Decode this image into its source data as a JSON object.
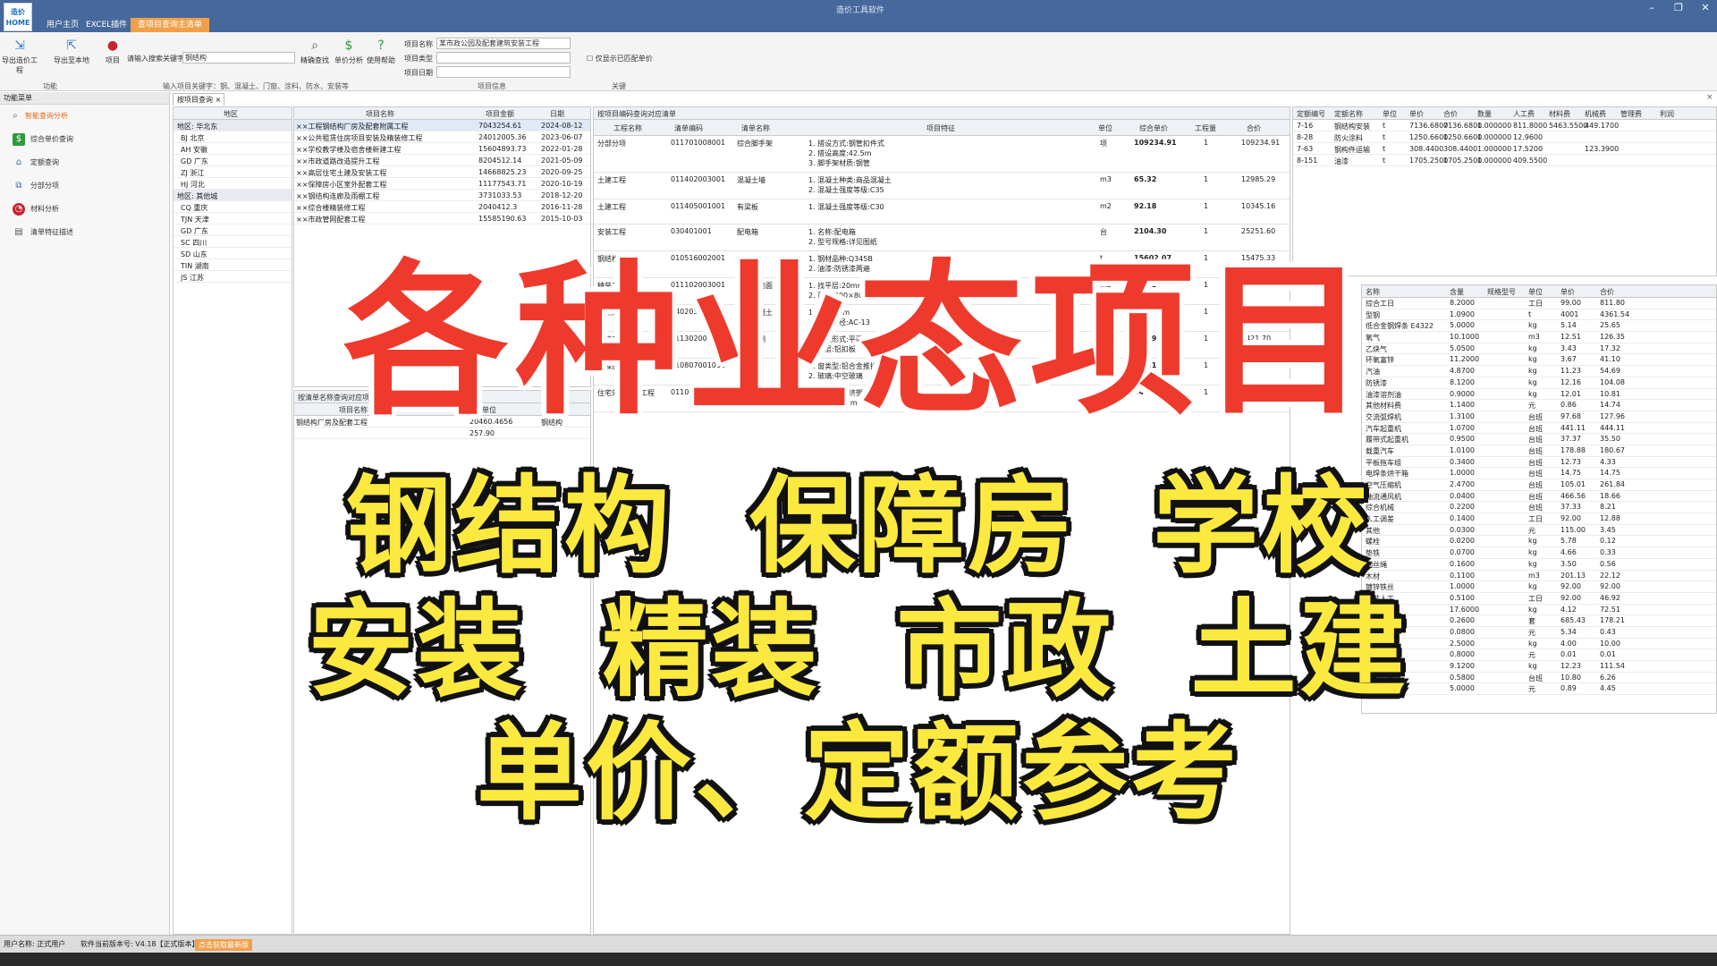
{
  "app": {
    "logo_text": "造价 HOME",
    "window_title": "造价工具软件",
    "menu_tabs": [
      "用户主页",
      "EXCEL插件",
      "查项目查询主清单"
    ],
    "active_tab_index": 2
  },
  "ribbon": {
    "buttons": [
      {
        "label": "导出造价工程",
        "icon": "export-icon"
      },
      {
        "label": "导出至本地",
        "icon": "export-local-icon"
      },
      {
        "label": "项目",
        "icon": "chart-icon"
      }
    ],
    "search_label": "请输入搜索关键字",
    "search_value": "钢结构",
    "tool_buttons": [
      {
        "label": "精确查找",
        "icon": "magnifier-icon"
      },
      {
        "label": "单价分析",
        "icon": "dollar-icon"
      },
      {
        "label": "使用帮助",
        "icon": "help-icon"
      }
    ],
    "info_fields": [
      {
        "label": "项目名称",
        "value": "某市政公园及配套建筑安装工程"
      },
      {
        "label": "项目类型",
        "value": ""
      },
      {
        "label": "项目日期",
        "value": ""
      }
    ],
    "checkbox_label": "仅显示已匹配单价",
    "groups": [
      "功能",
      "输入项目关键字：钢、混凝土、门窗、涂料、防水、安装等",
      "项目信息",
      "关键"
    ]
  },
  "sidebar": {
    "title": "功能菜单",
    "items": [
      {
        "label": "智能查询分析",
        "icon": "search-icon",
        "color": "#e06a1a"
      },
      {
        "label": "综合单价查询",
        "icon": "dollar-icon",
        "color": "#2e9a3b"
      },
      {
        "label": "定额查询",
        "icon": "house-icon",
        "color": "#2a6ccf"
      },
      {
        "label": "分部分项",
        "icon": "tree-icon",
        "color": "#3b6fb6"
      },
      {
        "label": "材料分析",
        "icon": "pie-icon",
        "color": "#c8242e"
      },
      {
        "label": "清单特征描述",
        "icon": "document-icon",
        "color": "#555555"
      }
    ]
  },
  "doc_tab": "按项目查询",
  "region_panel": {
    "header": "地区",
    "rows": [
      {
        "text": "地区: 华北东",
        "group": true
      },
      {
        "text": "BJ 北京"
      },
      {
        "text": "AH 安徽"
      },
      {
        "text": "GD 广东"
      },
      {
        "text": "ZJ 浙江"
      },
      {
        "text": "HJ 河北"
      },
      {
        "text": "地区: 其他城",
        "group": true
      },
      {
        "text": "CQ 重庆"
      },
      {
        "text": "TJN 天津"
      },
      {
        "text": "GD 广东"
      },
      {
        "text": "SC 四川"
      },
      {
        "text": "SD 山东"
      },
      {
        "text": "TIN 湖南"
      },
      {
        "text": "JS 江苏"
      }
    ]
  },
  "project_panel": {
    "headers": [
      "项目名称",
      "项目金额",
      "日期"
    ],
    "rows": [
      [
        "××工程钢结构厂房及配套附属工程",
        "7043254.61",
        "2024-08-12"
      ],
      [
        "××公共租赁住房项目安装及精装修工程",
        "24012005.36",
        "2023-06-07"
      ],
      [
        "××学校教学楼及宿舍楼新建工程",
        "15604893.73",
        "2022-01-28"
      ],
      [
        "××市政道路改造提升工程",
        "8204512.14",
        "2021-05-09"
      ],
      [
        "××高层住宅土建及安装工程",
        "14668825.23",
        "2020-09-25"
      ],
      [
        "××保障房小区室外配套工程",
        "11177543.71",
        "2020-10-19"
      ],
      [
        "××钢结构连廊及雨棚工程",
        "3731033.53",
        "2018-12-20"
      ],
      [
        "××综合楼精装修工程",
        "2040412.3",
        "2016-11-28"
      ],
      [
        "××市政管网配套工程",
        "15585190.63",
        "2015-10-03"
      ]
    ]
  },
  "sub_panel": {
    "title": "按清单名称查询对应项目",
    "headers": [
      "项目名称",
      "单位",
      "单价"
    ],
    "rows": [
      [
        "钢结构厂房及配套工程",
        "20460.4656",
        "钢结构"
      ],
      [
        "",
        "257.90",
        ""
      ]
    ]
  },
  "main_table": {
    "title": "按项目编码查询对应清单",
    "headers": [
      "工程名称",
      "清单编码",
      "清单名称",
      "项目特征",
      "单位",
      "综合单价",
      "工程量",
      "合价"
    ],
    "rows": [
      {
        "name": "分部分项",
        "code": "011701008001",
        "item": "综合脚手架",
        "desc": "1. 搭设方式:钢管扣件式\n2. 搭设高度:42.5m\n3. 脚手架材质:钢管",
        "unit": "项",
        "price": "109234.91",
        "qty": "1",
        "total": "109234.91"
      },
      {
        "name": "土建工程",
        "code": "011402003001",
        "item": "混凝土墙",
        "desc": "1. 混凝土种类:商品混凝土\n2. 混凝土强度等级:C35",
        "unit": "m3",
        "price": "65.32",
        "qty": "1",
        "total": "12985.29"
      },
      {
        "name": "土建工程",
        "code": "011405001001",
        "item": "有梁板",
        "desc": "1. 混凝土强度等级:C30",
        "unit": "m2",
        "price": "92.18",
        "qty": "1",
        "total": "10345.16"
      },
      {
        "name": "安装工程",
        "code": "030401001",
        "item": "配电箱",
        "desc": "1. 名称:配电箱\n2. 型号规格:详见图纸",
        "unit": "台",
        "price": "2104.30",
        "qty": "1",
        "total": "25251.60"
      },
      {
        "name": "钢结构工程",
        "code": "010516002001",
        "item": "钢构件",
        "desc": "1. 钢材品种:Q345B\n2. 油漆:防锈漆两遍",
        "unit": "t",
        "price": "15602.07",
        "qty": "1",
        "total": "15475.33"
      },
      {
        "name": "精装工程",
        "code": "011102003001",
        "item": "块料楼地面",
        "desc": "1. 找平层:20mm水泥砂浆\n2. 面层:800×800地砖",
        "unit": "m2",
        "price": "77.08",
        "qty": "1",
        "total": "5214.60"
      },
      {
        "name": "市政工程",
        "code": "040203006001",
        "item": "沥青混凝土",
        "desc": "1. 厚度:5cm\n2. 石料粒径:AC-13",
        "unit": "m2",
        "price": "535.31",
        "qty": "1",
        "total": "8126.52"
      },
      {
        "name": "学校工程",
        "code": "011302001001",
        "item": "吊顶天棚",
        "desc": "1. 吊顶形式:平面\n2. 面层:铝扣板",
        "unit": "m2",
        "price": "99.19",
        "qty": "1",
        "total": "3421.70"
      },
      {
        "name": "保障房工程",
        "code": "010807001001",
        "item": "金属窗",
        "desc": "1. 窗类型:铝合金推拉窗\n2. 玻璃:中空玻璃",
        "unit": "m2",
        "price": "415.19",
        "qty": "1",
        "total": "21050.40"
      },
      {
        "name": "住宅外墙保温工程",
        "code": "011001003001",
        "item": "保温隔热墙面",
        "desc": "1. 保温材料:挤塑聚苯板\n2. 厚度:30mm",
        "unit": "m2",
        "price": "547.23",
        "qty": "1",
        "total": "70408.26"
      }
    ]
  },
  "quota_table": {
    "headers": [
      "定额编号",
      "定额名称",
      "单位",
      "单价",
      "合价",
      "数量",
      "人工费",
      "材料费",
      "机械费",
      "管理费",
      "利润"
    ],
    "rows": [
      [
        "7-16",
        "钢结构安装",
        "t",
        "7136.6800",
        "7136.6800",
        "1.000000",
        "811.8000",
        "5463.5500",
        "449.1700",
        "",
        ""
      ],
      [
        "8-28",
        "防火涂料",
        "t",
        "1250.6600",
        "1250.6600",
        "1.000000",
        "12.9600",
        "",
        "",
        "",
        ""
      ],
      [
        "7-63",
        "钢构件运输",
        "t",
        "308.4400",
        "308.4400",
        "1.000000",
        "17.5200",
        "",
        "123.3900",
        "",
        ""
      ],
      [
        "8-151",
        "油漆",
        "t",
        "1705.2500",
        "1705.2500",
        "1.000000",
        "409.5500",
        "",
        "",
        "",
        ""
      ]
    ]
  },
  "material_table": {
    "headers": [
      "名称",
      "含量",
      "规格型号",
      "单位",
      "单价",
      "合价"
    ],
    "rows": [
      [
        "综合工日",
        "8.2000",
        "",
        "工日",
        "99.00",
        "811.80"
      ],
      [
        "型钢",
        "1.0900",
        "",
        "t",
        "4001",
        "4361.54"
      ],
      [
        "低合金钢焊条 E4322",
        "5.0000",
        "",
        "kg",
        "5.14",
        "25.65"
      ],
      [
        "氧气",
        "10.1000",
        "",
        "m3",
        "12.51",
        "126.35"
      ],
      [
        "乙炔气",
        "5.0500",
        "",
        "kg",
        "3.43",
        "17.32"
      ],
      [
        "环氧富锌",
        "11.2000",
        "",
        "kg",
        "3.67",
        "41.10"
      ],
      [
        "汽油",
        "4.8700",
        "",
        "kg",
        "11.23",
        "54.69"
      ],
      [
        "防锈漆",
        "8.1200",
        "",
        "kg",
        "12.16",
        "104.08"
      ],
      [
        "油漆溶剂油",
        "0.9000",
        "",
        "kg",
        "12.01",
        "10.81"
      ],
      [
        "其他材料费",
        "1.1400",
        "",
        "元",
        "0.86",
        "14.74"
      ],
      [
        "交流弧焊机",
        "1.3100",
        "",
        "台班",
        "97.68",
        "127.96"
      ],
      [
        "汽车起重机",
        "1.0700",
        "",
        "台班",
        "441.11",
        "444.11"
      ],
      [
        "履带式起重机",
        "0.9500",
        "",
        "台班",
        "37.37",
        "35.50"
      ],
      [
        "载重汽车",
        "1.0100",
        "",
        "台班",
        "178.88",
        "180.67"
      ],
      [
        "平板拖车组",
        "0.3400",
        "",
        "台班",
        "12.73",
        "4.33"
      ],
      [
        "电焊条烘干箱",
        "1.0000",
        "",
        "台班",
        "14.75",
        "14.75"
      ],
      [
        "空气压缩机",
        "2.4700",
        "",
        "台班",
        "105.01",
        "261.84"
      ],
      [
        "轴流通风机",
        "0.0400",
        "",
        "台班",
        "466.56",
        "18.66"
      ],
      [
        "综合机械",
        "0.2200",
        "",
        "台班",
        "37.33",
        "8.21"
      ],
      [
        "人工调差",
        "0.1400",
        "",
        "工日",
        "92.00",
        "12.88"
      ],
      [
        "其他",
        "0.0300",
        "",
        "元",
        "115.00",
        "3.45"
      ],
      [
        "螺栓",
        "0.0200",
        "",
        "kg",
        "5.78",
        "0.12"
      ],
      [
        "垫铁",
        "0.0700",
        "",
        "kg",
        "4.66",
        "0.33"
      ],
      [
        "钢丝绳",
        "0.1600",
        "",
        "kg",
        "3.50",
        "0.56"
      ],
      [
        "木材",
        "0.1100",
        "",
        "m3",
        "201.13",
        "22.12"
      ],
      [
        "镀锌铁丝",
        "1.0000",
        "",
        "kg",
        "92.00",
        "92.00"
      ],
      [
        "安装人工",
        "0.5100",
        "",
        "工日",
        "92.00",
        "46.92"
      ],
      [
        "钢垫板",
        "17.6000",
        "",
        "kg",
        "4.12",
        "72.51"
      ],
      [
        "六角螺栓",
        "0.2600",
        "",
        "套",
        "685.43",
        "178.21"
      ],
      [
        "机械费",
        "0.0800",
        "",
        "元",
        "5.34",
        "0.43"
      ],
      [
        "加工费",
        "2.5000",
        "",
        "kg",
        "4.00",
        "10.00"
      ],
      [
        "辅助材料",
        "0.8000",
        "",
        "元",
        "0.01",
        "0.01"
      ],
      [
        "钢板",
        "9.1200",
        "",
        "kg",
        "12.23",
        "111.54"
      ],
      [
        "其他机械",
        "0.5800",
        "",
        "台班",
        "10.80",
        "6.26"
      ],
      [
        "其他费用",
        "5.0000",
        "",
        "元",
        "0.89",
        "4.45"
      ]
    ]
  },
  "status": {
    "user": "用户名称: 正式用户",
    "version": "软件当前版本号: V4.18【正式版本】",
    "highlight": "点击获取最新版"
  },
  "overlay": {
    "line1": "各种业态项目",
    "line2": "钢结构 保障房 学校",
    "line3": "安装 精装 市政 土建",
    "line4": "单价、定额参考"
  }
}
